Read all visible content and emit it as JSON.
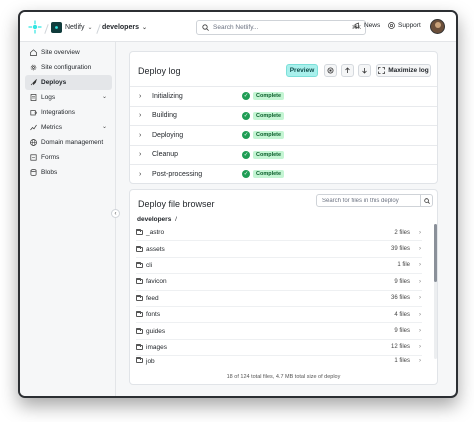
{
  "topbar": {
    "team_name": "Netlify",
    "site_name": "developers",
    "search_placeholder": "Search Netlify...",
    "search_shortcut": "⌘K",
    "news_label": "News",
    "support_label": "Support",
    "brand_color": "#32e6e2"
  },
  "sidebar": {
    "items": [
      {
        "label": "Site overview",
        "icon": "home-icon"
      },
      {
        "label": "Site configuration",
        "icon": "gear-icon"
      },
      {
        "label": "Deploys",
        "icon": "rocket-icon",
        "active": true
      },
      {
        "label": "Logs",
        "icon": "document-icon",
        "has_children": true
      },
      {
        "label": "Integrations",
        "icon": "puzzle-icon"
      },
      {
        "label": "Metrics",
        "icon": "chart-icon",
        "has_children": true
      },
      {
        "label": "Domain management",
        "icon": "globe-icon"
      },
      {
        "label": "Forms",
        "icon": "form-icon"
      },
      {
        "label": "Blobs",
        "icon": "database-icon"
      }
    ]
  },
  "deploy_log": {
    "title": "Deploy log",
    "preview_label": "Preview",
    "maximize_label": "Maximize log",
    "steps": [
      {
        "label": "Initializing",
        "status": "Complete"
      },
      {
        "label": "Building",
        "status": "Complete"
      },
      {
        "label": "Deploying",
        "status": "Complete"
      },
      {
        "label": "Cleanup",
        "status": "Complete"
      },
      {
        "label": "Post-processing",
        "status": "Complete"
      }
    ],
    "status_color": "#1f9d55"
  },
  "file_browser": {
    "title": "Deploy file browser",
    "search_placeholder": "Search for files in this deploy",
    "breadcrumb_root": "developers",
    "breadcrumb_sep": "/",
    "files": [
      {
        "name": "_astro",
        "count": "2 files"
      },
      {
        "name": "assets",
        "count": "39 files"
      },
      {
        "name": "cli",
        "count": "1 file"
      },
      {
        "name": "favicon",
        "count": "9 files"
      },
      {
        "name": "feed",
        "count": "36 files"
      },
      {
        "name": "fonts",
        "count": "4 files"
      },
      {
        "name": "guides",
        "count": "9 files"
      },
      {
        "name": "images",
        "count": "12 files"
      },
      {
        "name": "job",
        "count": "1 files"
      }
    ],
    "footer": "18 of 124 total files, 4.7 MB total size of deploy"
  }
}
